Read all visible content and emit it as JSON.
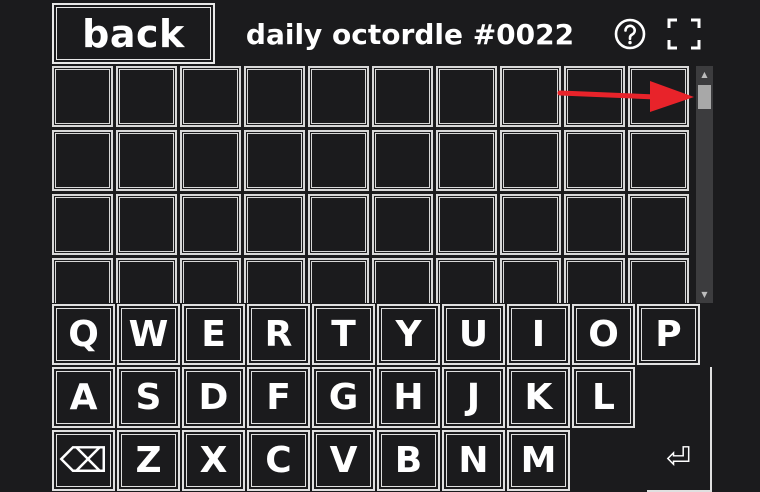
{
  "header": {
    "back_label": "back",
    "title": "daily octordle #0022",
    "help_icon": "help-circle-icon",
    "fullscreen_icon": "fullscreen-icon"
  },
  "board": {
    "rows": 4,
    "columns": 10
  },
  "annotation": {
    "arrow_color": "#e8232a",
    "points_to": "scrollbar-thumb"
  },
  "keyboard": {
    "row1": [
      "Q",
      "W",
      "E",
      "R",
      "T",
      "Y",
      "U",
      "I",
      "O",
      "P"
    ],
    "row2": [
      "A",
      "S",
      "D",
      "F",
      "G",
      "H",
      "J",
      "K",
      "L"
    ],
    "row3": [
      "Z",
      "X",
      "C",
      "V",
      "B",
      "N",
      "M"
    ],
    "backspace_label": "⌫",
    "enter_label": "⏎"
  },
  "colors": {
    "background": "#1b1b1d",
    "border": "#e0e0e0",
    "text": "#ffffff"
  }
}
